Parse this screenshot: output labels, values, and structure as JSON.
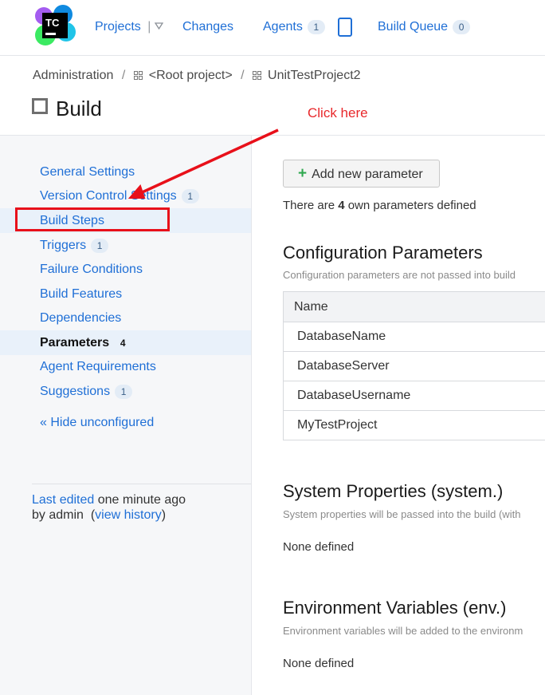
{
  "header": {
    "logo_text": "TC",
    "nav": {
      "projects": "Projects",
      "changes": "Changes",
      "agents": "Agents",
      "agents_count": "1",
      "build_queue": "Build Queue",
      "build_queue_count": "0"
    }
  },
  "breadcrumb": {
    "admin": "Administration",
    "root": "<Root project>",
    "project": "UnitTestProject2",
    "separator": "/"
  },
  "page_title": "Build",
  "sidebar": {
    "items": [
      {
        "label": "General Settings",
        "badge": ""
      },
      {
        "label": "Version Control Settings",
        "badge": "1"
      },
      {
        "label": "Build Steps",
        "badge": ""
      },
      {
        "label": "Triggers",
        "badge": "1"
      },
      {
        "label": "Failure Conditions",
        "badge": ""
      },
      {
        "label": "Build Features",
        "badge": ""
      },
      {
        "label": "Dependencies",
        "badge": ""
      },
      {
        "label": "Parameters",
        "badge": "4"
      },
      {
        "label": "Agent Requirements",
        "badge": ""
      },
      {
        "label": "Suggestions",
        "badge": "1"
      }
    ],
    "hide_unconfigured": "« Hide unconfigured",
    "last_edited_link": "Last edited",
    "last_edited_time": " one minute ago",
    "by_admin": "by admin",
    "view_history": "view history"
  },
  "content": {
    "add_button": "Add new parameter",
    "own_prefix": "There are ",
    "own_count": "4",
    "own_suffix": " own parameters defined",
    "config": {
      "title": "Configuration Parameters",
      "desc": "Configuration parameters are not passed into build",
      "column_name": "Name",
      "rows": [
        "DatabaseName",
        "DatabaseServer",
        "DatabaseUsername",
        "MyTestProject"
      ]
    },
    "system": {
      "title": "System Properties (system.)",
      "desc": "System properties will be passed into the build (with",
      "none": "None defined"
    },
    "env": {
      "title": "Environment Variables (env.)",
      "desc": "Environment variables will be added to the environm",
      "none": "None defined"
    }
  },
  "annotation": {
    "text": "Click here",
    "color": "#e8282b"
  },
  "colors": {
    "link": "#1f6fd6",
    "active_bg": "#e9f1fa",
    "sidebar_bg": "#f6f7f9"
  }
}
